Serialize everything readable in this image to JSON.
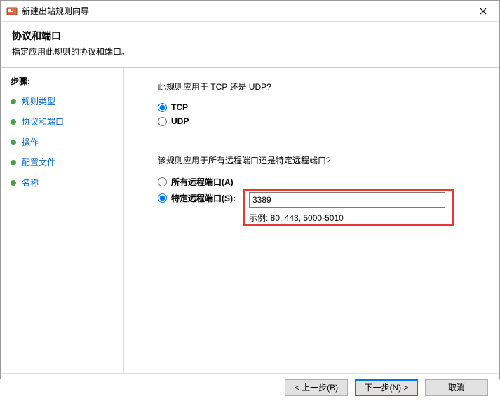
{
  "window": {
    "title": "新建出站规则向导"
  },
  "header": {
    "title": "协议和端口",
    "subtitle": "指定应用此规则的协议和端口。"
  },
  "sidebar": {
    "steps_label": "步骤:",
    "items": [
      {
        "label": "规则类型"
      },
      {
        "label": "协议和端口"
      },
      {
        "label": "操作"
      },
      {
        "label": "配置文件"
      },
      {
        "label": "名称"
      }
    ]
  },
  "main": {
    "question1": "此规则应用于 TCP 还是 UDP?",
    "protocol": {
      "tcp_label": "TCP",
      "udp_label": "UDP",
      "selected": "tcp"
    },
    "question2": "该规则应用于所有远程端口还是特定远程端口?",
    "ports": {
      "all_label": "所有远程端口(A)",
      "specific_label": "特定远程端口(S):",
      "selected": "specific",
      "value": "3389",
      "example": "示例: 80, 443, 5000-5010"
    }
  },
  "footer": {
    "back": "< 上一步(B)",
    "next": "下一步(N) >",
    "cancel": "取消"
  }
}
